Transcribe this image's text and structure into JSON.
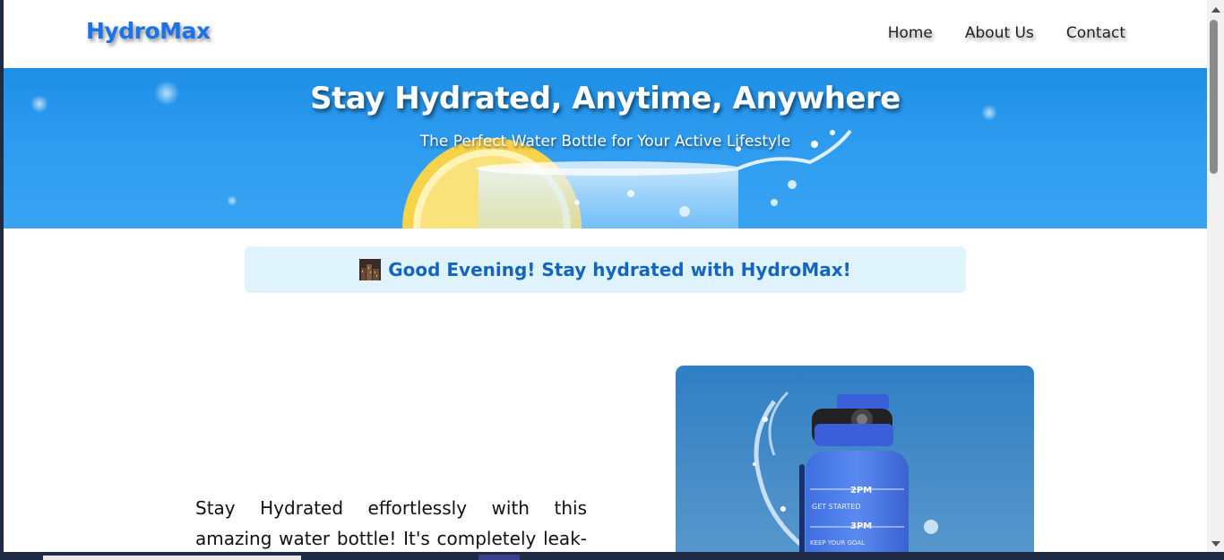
{
  "header": {
    "logo": "HydroMax",
    "nav": [
      "Home",
      "About Us",
      "Contact"
    ]
  },
  "hero": {
    "title": "Stay Hydrated, Anytime, Anywhere",
    "subtitle": "The Perfect Water Bottle for Your Active Lifestyle"
  },
  "greeting": {
    "icon": "night-city-icon",
    "text": "Good Evening! Stay hydrated with HydroMax!"
  },
  "content": {
    "description": "Stay Hydrated effortlessly with this amazing water bottle! It's completely leak-proof, making it perfect for your"
  },
  "product_bottle_labels": [
    "2PM",
    "GET STARTED",
    "3PM",
    "KEEP YOUR GOAL"
  ],
  "colors": {
    "brand": "#1a73e8",
    "hero_bg": "#2e9cf0",
    "greeting_bg": "#dff3fc",
    "greeting_text": "#1565c0"
  }
}
